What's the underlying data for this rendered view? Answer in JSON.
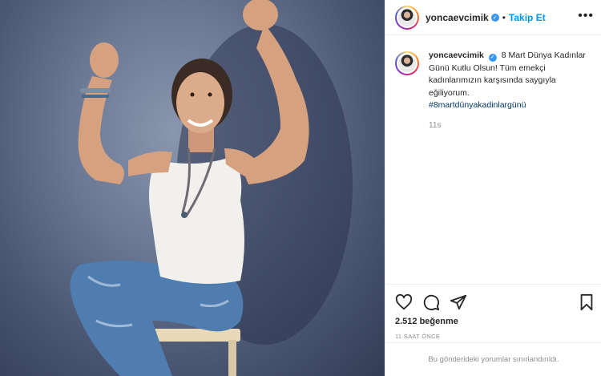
{
  "post": {
    "username": "yoncaevcimik",
    "follow_label": "Takip Et",
    "separator": "•",
    "more_label": "•••",
    "verified_mark": "✓",
    "caption_text": "8 Mart Dünya Kadınlar Günü Kutlu Olsun! Tüm emekçi kadınlarımızın karşısında saygıyla eğiliyorum.",
    "hashtag": "#8martdünyakadinlargünü",
    "caption_time": "11s",
    "likes_text": "2.512 beğenme",
    "time_ago": "11 SAAT ÖNCE",
    "comments_limited_text": "Bu gönderideki yorumlar sınırlandırıldı."
  },
  "icons": {
    "like": "heart-icon",
    "comment": "comment-icon",
    "share": "share-icon",
    "save": "bookmark-icon",
    "verified": "verified-icon",
    "more": "more-options-icon"
  },
  "colors": {
    "link_blue": "#0095f6",
    "verified_blue": "#3897f0",
    "hashtag_blue": "#00376b",
    "muted_text": "#8e8e8e",
    "divider": "#efefef"
  }
}
